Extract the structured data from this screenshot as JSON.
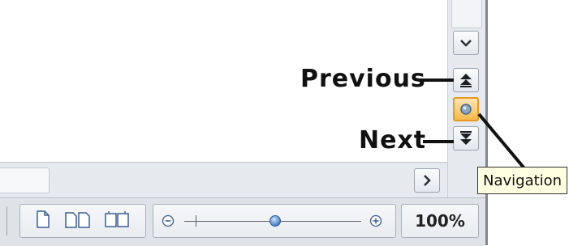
{
  "annotations": {
    "previous_label": "Previous",
    "next_label": "Next"
  },
  "tooltip": {
    "text": "Navigation"
  },
  "statusbar": {
    "zoom_percent": "100%",
    "zoom_level": 100
  },
  "icons": {
    "scroll_down": "chevron-down-icon",
    "previous": "double-chevron-up-icon",
    "navigation": "navigation-circle-icon",
    "next": "double-chevron-down-icon",
    "scroll_right": "chevron-right-icon",
    "page_single": "single-page-icon",
    "page_multi": "multi-page-icon",
    "page_book": "book-view-icon",
    "zoom_out": "zoom-out-icon",
    "zoom_in": "zoom-in-icon"
  },
  "colors": {
    "navigation_button": "#f3b94a",
    "tooltip_background": "#ffffe1"
  }
}
